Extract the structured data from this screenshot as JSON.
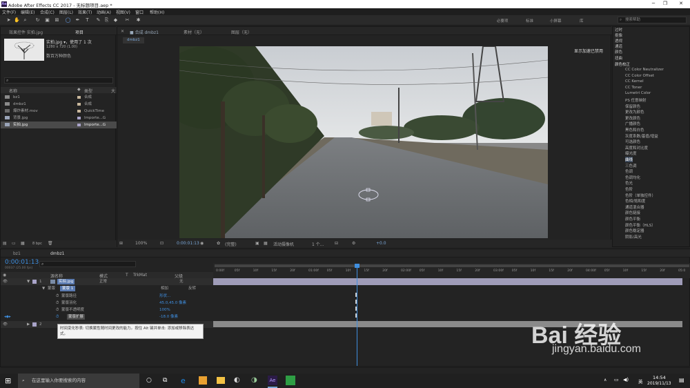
{
  "window": {
    "title": "Adobe After Effects CC 2017 - 无标题项目.aep *",
    "minimize": "─",
    "maximize": "❐",
    "close": "✕"
  },
  "menu": [
    "文件(F)",
    "编辑(E)",
    "合成(C)",
    "图层(L)",
    "效果(T)",
    "动画(A)",
    "视图(V)",
    "窗口",
    "帮助(H)"
  ],
  "workspaces": [
    "必要项",
    "标准",
    "小屏幕",
    "库"
  ],
  "help_search_placeholder": "搜索帮助",
  "project": {
    "tab_effects": "效果控件 实拍.jpg",
    "tab_project": "项目",
    "asset_name": "实拍.jpg ▾，使用了 1 次",
    "asset_dims": "1280 x 720 (1.00)",
    "asset_colors": "数百万种颜色",
    "col_name": "名称",
    "col_type": "类型",
    "col_size": "大",
    "items": [
      {
        "name": "bz1",
        "type": "合成",
        "color": "#c9b79c"
      },
      {
        "name": "dmbz1",
        "type": "合成",
        "color": "#c9b79c"
      },
      {
        "name": "爆炸素材.mov",
        "type": "QuickTime",
        "color": "#c9b79c"
      },
      {
        "name": "背景.jpg",
        "type": "Importe...G",
        "color": "#a9a4c9"
      },
      {
        "name": "实拍.jpg",
        "type": "Importe...G",
        "color": "#a9a4c9"
      }
    ],
    "bpc": "8 bpc"
  },
  "comp": {
    "tab_comp": "合成 dmbz1",
    "tab_footage": "素材（无）",
    "tab_layer": "图层（无）",
    "breadcrumb": "dmbz1",
    "gpu_note": "显示加速已禁用",
    "zoom": "100%",
    "timecode": "0:00:01:13",
    "quality": "(完整)",
    "camera": "活动摄像机",
    "views": "1 个...",
    "offset": "+0.0"
  },
  "effects": {
    "folders_top": [
      "过时",
      "抠像",
      "透视",
      "通道",
      "颜色",
      "扭曲"
    ],
    "color_folder": "颜色校正",
    "items": [
      "CC Color Neutralizer",
      "CC Color Offset",
      "CC Kernel",
      "CC Toner",
      "Lumetri Color",
      "PS 任意映射",
      "保留颜色",
      "更改为颜色",
      "更改颜色",
      "广播颜色",
      "黑色和白色",
      "灰度系数/基值/增益",
      "可选颜色",
      "高度和对比度",
      "曝光度",
      "曲线",
      "三色调",
      "色调",
      "色调均化",
      "色光",
      "色阶",
      "色阶（单独控件）",
      "色相/饱和度",
      "通道混合器",
      "颜色链接",
      "颜色平衡",
      "颜色平衡（HLS）",
      "颜色稳定器",
      "阴影/高光"
    ]
  },
  "timeline": {
    "tab1": "bz1",
    "tab2": "dmbz1",
    "timecode": "0:00:01:13",
    "timecode_sub": "00037 (25.00 fps)",
    "headers": {
      "source": "源名称",
      "mode": "模式",
      "t": "T",
      "trkmat": "TrkMat",
      "parent": "父级"
    },
    "ruler": [
      "0:00f",
      "05f",
      "10f",
      "15f",
      "20f",
      "01:00f",
      "05f",
      "10f",
      "15f",
      "20f",
      "02:00f",
      "05f",
      "10f",
      "15f",
      "20f",
      "03:00f",
      "05f",
      "10f",
      "15f",
      "20f",
      "04:00f",
      "05f",
      "10f",
      "15f",
      "20f",
      "05:0"
    ],
    "layer1": {
      "num": "1",
      "name": "实拍.jpg",
      "mode": "正常",
      "parent": "无"
    },
    "masks_group": "蒙版",
    "mask1": "蒙版 1",
    "mask_mode": "相加",
    "mask_invert": "反转",
    "props": [
      {
        "name": "蒙版路径",
        "value": "形状..."
      },
      {
        "name": "蒙版羽化",
        "value": "45.0,45.0 像素"
      },
      {
        "name": "蒙版不透明度",
        "value": "100%"
      },
      {
        "name": "蒙版扩展",
        "value": "-18.0 像素"
      }
    ],
    "layer2": {
      "num": "2"
    },
    "tooltip": "时间变化秒表: 切换属性随时间更改的能力。按住 Alt 键并单击: 添加或移除表达式。"
  },
  "taskbar": {
    "search": "在这里输入你要搜索的内容",
    "time": "14:54",
    "date": "2019/11/13",
    "ime": "英"
  },
  "watermark": {
    "main": "Bai 经验",
    "sub": "jingyan.baidu.com"
  }
}
